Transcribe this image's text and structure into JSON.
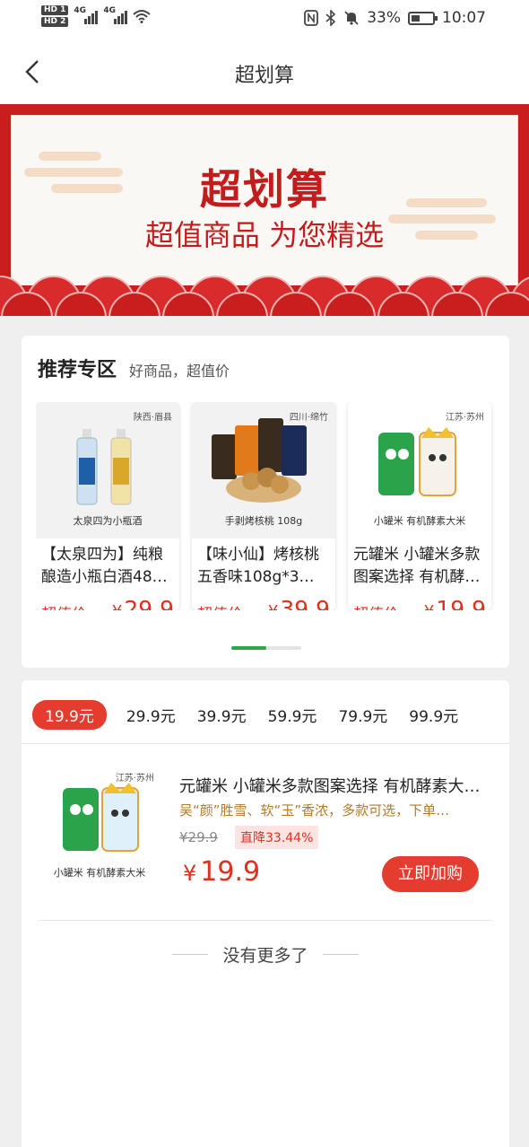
{
  "status_bar": {
    "sim1": "HD 1",
    "sim2": "HD 2",
    "net1": "4G",
    "net2": "4G",
    "battery": "33%",
    "time": "10:07",
    "icons": [
      "nfc-icon",
      "bluetooth-icon",
      "mute-icon",
      "battery-icon",
      "wifi-icon"
    ]
  },
  "nav": {
    "title": "超划算"
  },
  "banner": {
    "title": "超划算",
    "subtitle": "超值商品 为您精选"
  },
  "recommend": {
    "title": "推荐专区",
    "subtitle": "好商品，超值价",
    "products": [
      {
        "tag": "陕西·眉县",
        "caption": "太泉四为小瓶酒",
        "name": "【太泉四为】纯粮酿造小瓶白酒48…",
        "price_label": "超值价",
        "currency": "¥",
        "price": "29.9"
      },
      {
        "tag": "四川·绵竹",
        "caption": "手剥烤核桃 108g",
        "name": "【味小仙】烤核桃五香味108g*3…",
        "price_label": "超值价",
        "currency": "¥",
        "price": "39.9"
      },
      {
        "tag": "江苏·苏州",
        "caption": "小罐米 有机酵素大米",
        "name": "元罐米 小罐米多款图案选择 有机酵…",
        "price_label": "超值价",
        "currency": "¥",
        "price": "19.9"
      }
    ],
    "pager_progress": 0.5
  },
  "price_tabs": [
    "19.9元",
    "29.9元",
    "39.9元",
    "59.9元",
    "79.9元",
    "99.9元"
  ],
  "active_tab": "19.9元",
  "list_item": {
    "tag": "江苏·苏州",
    "caption": "小罐米 有机酵素大米",
    "title": "元罐米 小罐米多款图案选择 有机酵素大…",
    "desc": "吴“颜”胜雪、软“玉”香浓，多款可选，下单…",
    "old_price": "¥29.9",
    "discount": "直降33.44%",
    "currency": "¥",
    "price": "19.9",
    "buy_label": "立即加购"
  },
  "footer": {
    "no_more": "没有更多了"
  },
  "colors": {
    "accent": "#e43c2f",
    "banner_red": "#c81e1e",
    "pager_green": "#2aa84a"
  }
}
